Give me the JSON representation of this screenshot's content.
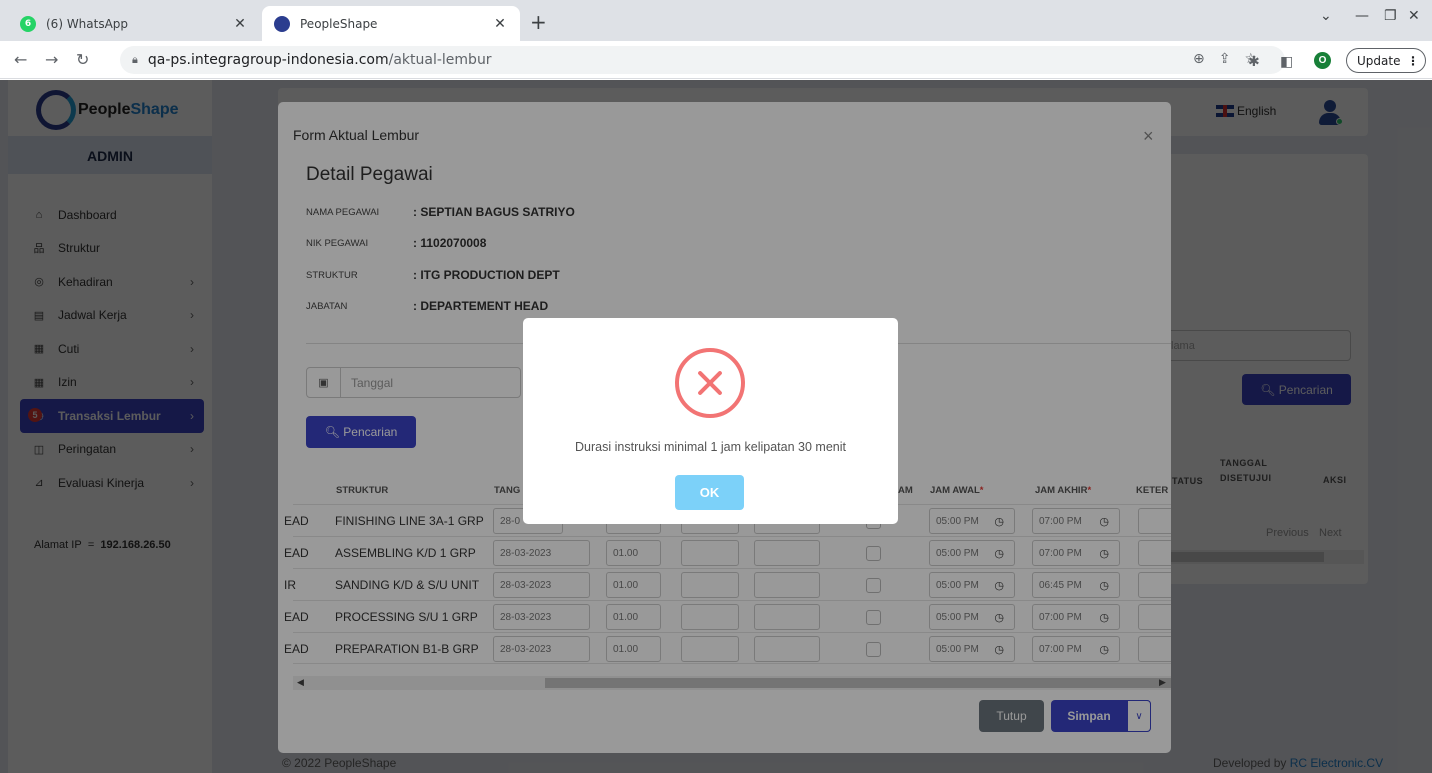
{
  "browser": {
    "tabs": [
      {
        "title": "(6) WhatsApp",
        "badge": "6"
      },
      {
        "title": "PeopleShape"
      }
    ],
    "url_host": "qa-ps.integragroup-indonesia.com",
    "url_path": "/aktual-lembur",
    "profile_initial": "O",
    "update_label": "Update"
  },
  "sidebar": {
    "logo_part1": "People",
    "logo_part2": "Shape",
    "role": "ADMIN",
    "items": [
      {
        "label": "Dashboard",
        "icon": "home-icon",
        "glyph": "⌂",
        "chevron": false
      },
      {
        "label": "Struktur",
        "icon": "sitemap-icon",
        "glyph": "品",
        "chevron": false
      },
      {
        "label": "Kehadiran",
        "icon": "fingerprint-icon",
        "glyph": "◎",
        "chevron": true
      },
      {
        "label": "Jadwal Kerja",
        "icon": "calendar-icon",
        "glyph": "▤",
        "chevron": true
      },
      {
        "label": "Cuti",
        "icon": "calendar-icon",
        "glyph": "▦",
        "chevron": true
      },
      {
        "label": "Izin",
        "icon": "calendar-icon",
        "glyph": "▦",
        "chevron": true
      },
      {
        "label": "Transaksi Lembur",
        "icon": "clock-icon",
        "glyph": "◷",
        "chevron": true,
        "active": true,
        "badge": "5"
      },
      {
        "label": "Peringatan",
        "icon": "warning-icon",
        "glyph": "◫",
        "chevron": true
      },
      {
        "label": "Evaluasi Kinerja",
        "icon": "chart-icon",
        "glyph": "⊿",
        "chevron": true
      }
    ],
    "ip_label": "Alamat IP",
    "ip_sep": "=",
    "ip_value": "192.168.26.50"
  },
  "header": {
    "language": "English"
  },
  "background": {
    "search_placeholder_frag": "lama",
    "search_button": "Pencarian",
    "th_status": "TATUS",
    "th_tanggal": "TANGGAL",
    "th_disetujui": "DISETUJUI",
    "th_aksi": "AKSI",
    "pager_prev": "Previous",
    "pager_next": "Next"
  },
  "footer": {
    "copyright": "© 2022 PeopleShape",
    "dev_prefix": "Developed by",
    "dev_link": "RC Electronic.CV"
  },
  "form": {
    "title": "Form Aktual Lembur",
    "section": "Detail Pegawai",
    "info": [
      {
        "label": "NAMA PEGAWAI",
        "value": ": SEPTIAN BAGUS SATRIYO"
      },
      {
        "label": "NIK PEGAWAI",
        "value": ": 1102070008"
      },
      {
        "label": "STRUKTUR",
        "value": ": ITG PRODUCTION DEPT"
      },
      {
        "label": "JABATAN",
        "value": ": DEPARTEMENT HEAD"
      }
    ],
    "date_placeholder": "Tanggal",
    "search_button": "Pencarian",
    "headers": {
      "struktur": "STRUKTUR",
      "tanggal": "TANG",
      "am": "AM",
      "jam_awal": "JAM AWAL",
      "jam_akhir": "JAM AKHIR",
      "keter": "KETER"
    },
    "rows": [
      {
        "prefix": "EAD",
        "struktur": "FINISHING LINE 3A-1 GRP",
        "tanggal": "28-0",
        "durasi": "",
        "jam_awal": "05:00 PM",
        "jam_akhir": "07:00 PM"
      },
      {
        "prefix": "EAD",
        "struktur": "ASSEMBLING K/D 1 GRP",
        "tanggal": "28-03-2023",
        "durasi": "01.00",
        "jam_awal": "05:00 PM",
        "jam_akhir": "07:00 PM"
      },
      {
        "prefix": "IR",
        "struktur": "SANDING K/D & S/U UNIT",
        "tanggal": "28-03-2023",
        "durasi": "01.00",
        "jam_awal": "05:00 PM",
        "jam_akhir": "06:45 PM"
      },
      {
        "prefix": "EAD",
        "struktur": "PROCESSING S/U 1 GRP",
        "tanggal": "28-03-2023",
        "durasi": "01.00",
        "jam_awal": "05:00 PM",
        "jam_akhir": "07:00 PM"
      },
      {
        "prefix": "EAD",
        "struktur": "PREPARATION B1-B GRP",
        "tanggal": "28-03-2023",
        "durasi": "01.00",
        "jam_awal": "05:00 PM",
        "jam_akhir": "07:00 PM"
      }
    ],
    "btn_close": "Tutup",
    "btn_save": "Simpan"
  },
  "alert": {
    "message": "Durasi instruksi minimal 1 jam kelipatan 30 menit",
    "ok": "OK"
  },
  "colors": {
    "primary": "#3b43c7",
    "error": "#f27474",
    "ok_button": "#7cd1f9"
  }
}
